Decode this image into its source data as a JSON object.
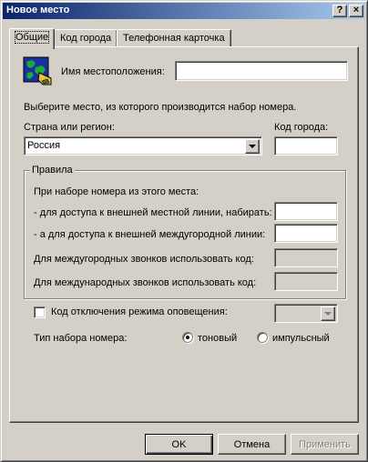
{
  "window": {
    "title": "Новое место",
    "help_glyph": "?",
    "close_glyph": "×"
  },
  "tabs": [
    {
      "label": "Общие",
      "active": true
    },
    {
      "label": "Код города",
      "active": false
    },
    {
      "label": "Телефонная карточка",
      "active": false
    }
  ],
  "general": {
    "location_name_label": "Имя местоположения:",
    "location_name_value": "",
    "instruction": "Выберите место, из которого производится набор номера.",
    "country_label": "Страна или регион:",
    "country_value": "Россия",
    "area_code_label": "Код города:",
    "area_code_value": ""
  },
  "rules": {
    "legend": "Правила",
    "intro": "При наборе номера из этого места:",
    "local_line_label": "- для доступа к внешней местной линии, набирать:",
    "local_line_value": "",
    "long_distance_line_label": "- а для доступа к внешней междугородной линии:",
    "long_distance_line_value": "",
    "long_distance_code_label": "Для междугородных звонков использовать код:",
    "international_code_label": "Для международных звонков использовать код:"
  },
  "call_waiting": {
    "label": "Код отключения режима оповещения:",
    "checked": false
  },
  "dial_type": {
    "label": "Тип набора номера:",
    "options": [
      "тоновый",
      "импульсный"
    ],
    "selected": "тоновый"
  },
  "buttons": {
    "ok": "OK",
    "cancel": "Отмена",
    "apply": "Применить"
  },
  "colors": {
    "face": "#d4d0c8",
    "title_start": "#0a246a",
    "title_end": "#a6caf0"
  }
}
